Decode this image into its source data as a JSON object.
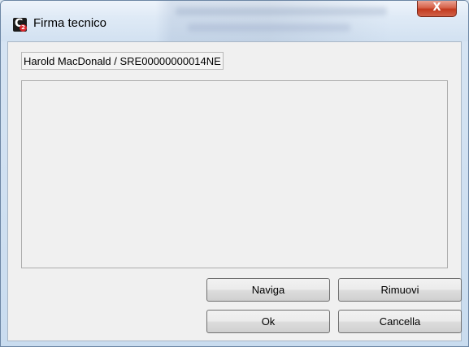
{
  "window": {
    "title": "Firma tecnico",
    "app_icon_letter": "C",
    "app_icon_badge": "2",
    "close_glyph": "X"
  },
  "technician": {
    "label": "Harold MacDonald / SRE00000000014NE"
  },
  "buttons": {
    "naviga": "Naviga",
    "rimuovi": "Rimuovi",
    "ok": "Ok",
    "cancella": "Cancella"
  },
  "icons": {
    "app": "app-logo-icon",
    "close": "close-icon"
  },
  "colors": {
    "close_button": "#c23a1f",
    "app_icon_badge": "#d8262b"
  }
}
